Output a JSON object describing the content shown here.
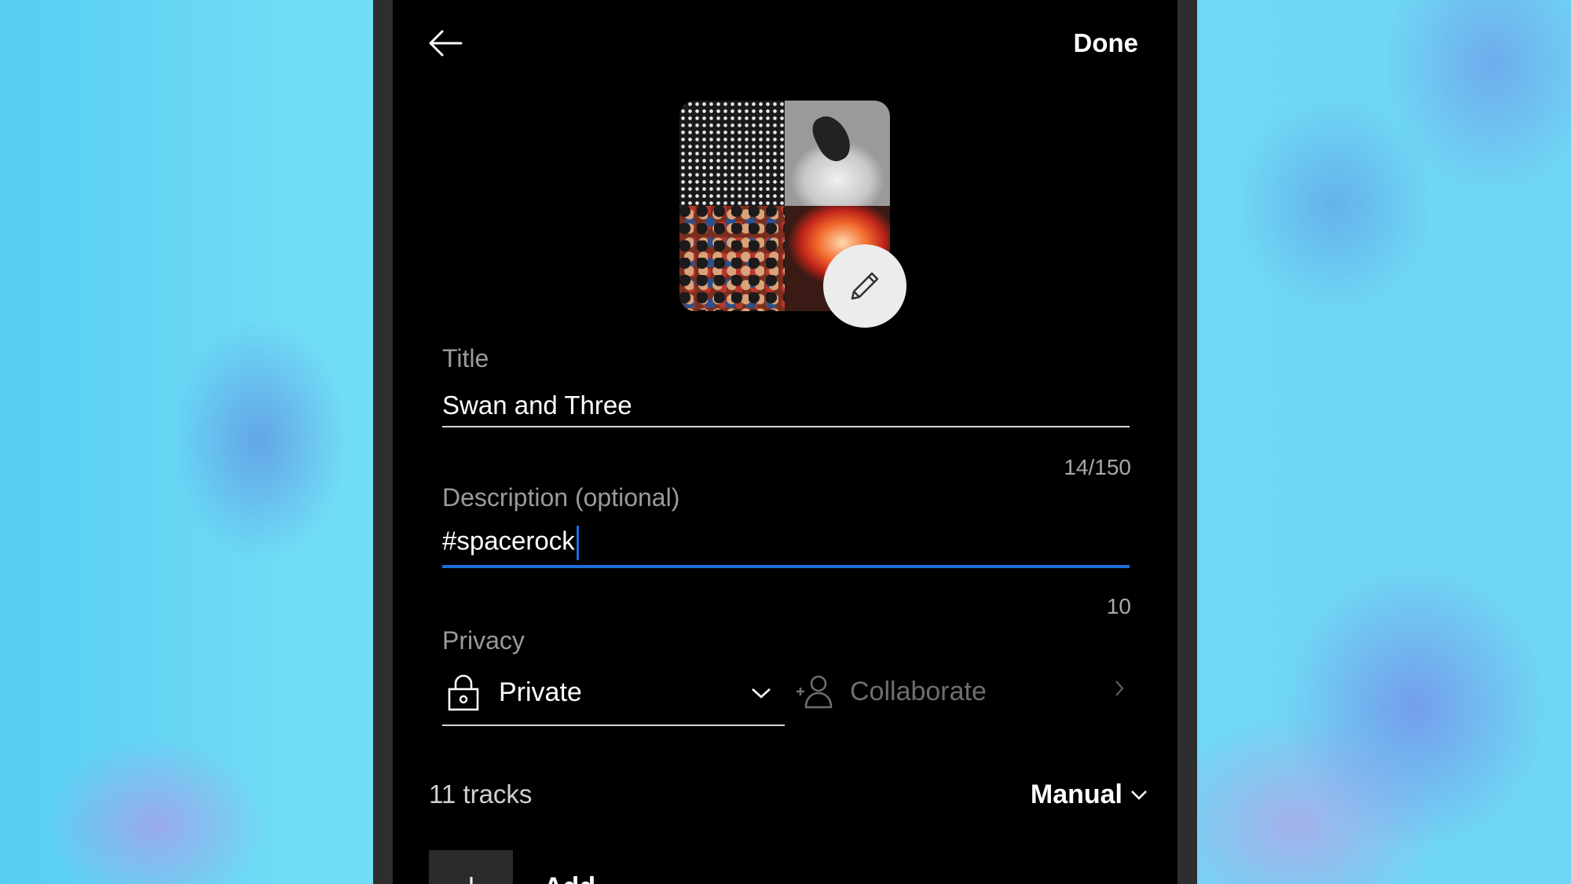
{
  "header": {
    "back_icon": "arrow-left-icon",
    "done_label": "Done"
  },
  "cover": {
    "edit_icon": "pencil-icon"
  },
  "form": {
    "title_label": "Title",
    "title_value": "Swan and Three",
    "title_counter": "14/150",
    "description_label": "Description (optional)",
    "description_value": "#spacerock",
    "description_counter": "10",
    "privacy_label": "Privacy",
    "privacy_value": "Private",
    "privacy_icon": "lock-icon",
    "collaborate_label": "Collaborate",
    "collaborate_icon": "add-person-icon"
  },
  "tracks": {
    "count_label": "11 tracks",
    "sort_label": "Manual",
    "add_label": "Add"
  },
  "colors": {
    "accent": "#1a6fd8",
    "screen_bg": "#000000",
    "bezel": "#2e2e2e"
  }
}
